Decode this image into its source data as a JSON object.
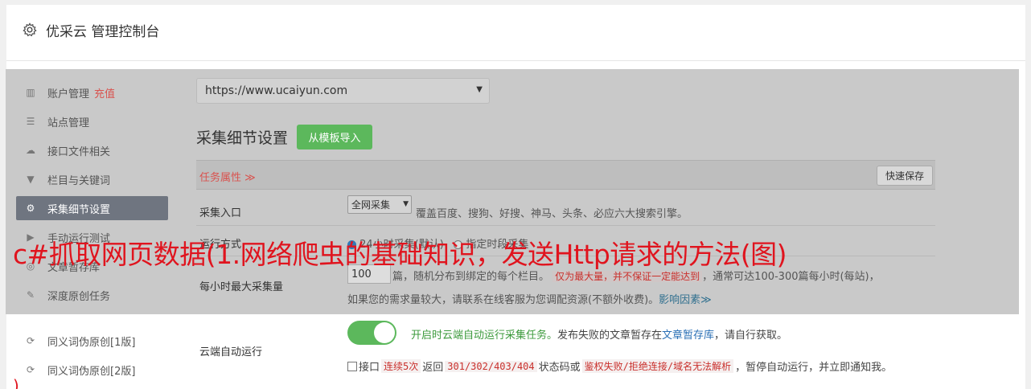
{
  "header": {
    "title": "优采云 管理控制台",
    "icon": "gear-icon"
  },
  "sidebar": {
    "items": [
      {
        "label": "账户管理",
        "badge": "充值",
        "icon": "bar-chart-icon"
      },
      {
        "label": "站点管理",
        "icon": "server-icon"
      },
      {
        "label": "接口文件相关",
        "icon": "cloud-upload-icon"
      },
      {
        "label": "栏目与关键词",
        "icon": "filter-icon"
      },
      {
        "label": "采集细节设置",
        "icon": "gears-icon",
        "active": true
      },
      {
        "label": "手动运行测试",
        "icon": "play-icon"
      },
      {
        "label": "文章暂存库",
        "icon": "database-icon"
      },
      {
        "label": "深度原创任务",
        "icon": "edit-icon"
      },
      {
        "label": "同义词伪原创[1版]",
        "icon": "refresh-icon"
      },
      {
        "label": "同义词伪原创[2版]",
        "icon": "refresh-icon"
      }
    ]
  },
  "main": {
    "site_select": "https://www.ucaiyun.com",
    "section_title": "采集细节设置",
    "import_button": "从模板导入",
    "task_attr_label": "任务属性 ≫",
    "quick_save": "快速保存",
    "entry": {
      "label": "采集入口",
      "select_value": "全网采集",
      "desc": "覆盖百度、搜狗、好搜、神马、头条、必应六大搜索引擎。"
    },
    "mode": {
      "label": "运行方式",
      "option1": "24小时采集(默认)",
      "option2": "指定时段采集"
    },
    "per_hour": {
      "label": "每小时最大采集量",
      "value": "100",
      "desc1": "篇，随机分布到绑定的每个栏目。",
      "warn": "仅为最大量，并不保证一定能达到",
      "desc2": "，通常可达100-300篇每小时(每站)，",
      "desc3": "如果您的需求量较大，请联系在线客服为您调配资源(不额外收费)。",
      "link": "影响因素≫"
    },
    "cloud": {
      "label": "云端自动运行",
      "enabled_text": "开启时云端自动运行采集任务。",
      "desc_mid": "发布失败的文章暂存在",
      "link": "文章暂存库",
      "desc_end": "，请自行获取。",
      "check_label": "接口",
      "code1": "连续5次",
      "text_return": "返回",
      "code2": "301/302/403/404",
      "text_or": "状态码或",
      "code3": "鉴权失败/拒绝连接/域名无法解析",
      "text_end": "，暂停自动运行，并立即通知我。"
    }
  },
  "overlay": {
    "headline": "c#抓取网页数据(1.网络爬虫的基础知识，发送Http请求的方法(图)",
    "bottom_char": ")"
  },
  "colors": {
    "accent_green": "#5cb85c",
    "overlay_red": "#e0141e",
    "active_sidebar": "#6f7580"
  }
}
